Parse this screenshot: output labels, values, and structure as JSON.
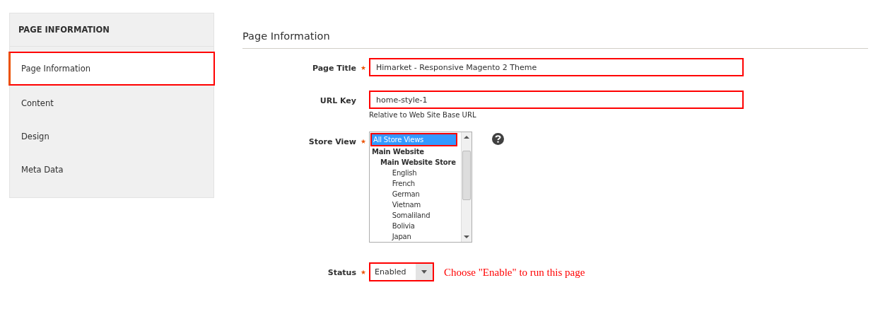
{
  "sidebar": {
    "title": "PAGE INFORMATION",
    "items": [
      {
        "label": "Page Information",
        "selected": true,
        "highlighted": true
      },
      {
        "label": "Content",
        "selected": false,
        "highlighted": false
      },
      {
        "label": "Design",
        "selected": false,
        "highlighted": false
      },
      {
        "label": "Meta Data",
        "selected": false,
        "highlighted": false
      }
    ]
  },
  "section": {
    "title": "Page Information"
  },
  "fields": [
    {
      "kind": "text",
      "label": "Page Title",
      "required": true,
      "value": "Himarket - Responsive Magento 2 Theme",
      "highlighted": true
    },
    {
      "kind": "text",
      "label": "URL Key",
      "required": false,
      "value": "home-style-1",
      "note": "Relative to Web Site Base URL",
      "highlighted": true
    },
    {
      "kind": "multiselect",
      "label": "Store View",
      "required": true,
      "help": true,
      "options": [
        {
          "label": "All Store Views",
          "selected": true,
          "highlighted": true
        },
        {
          "label": "Main Website",
          "selected": false,
          "highlighted": false,
          "children": [
            {
              "label": "Main Website Store",
              "selected": false,
              "highlighted": false,
              "children": [
                {
                  "label": "English",
                  "selected": false,
                  "highlighted": false
                },
                {
                  "label": "French",
                  "selected": false,
                  "highlighted": false
                },
                {
                  "label": "German",
                  "selected": false,
                  "highlighted": false
                },
                {
                  "label": "Vietnam",
                  "selected": false,
                  "highlighted": false
                },
                {
                  "label": "Somaliland",
                  "selected": false,
                  "highlighted": false
                },
                {
                  "label": "Bolivia",
                  "selected": false,
                  "highlighted": false
                },
                {
                  "label": "Japan",
                  "selected": false,
                  "highlighted": false
                }
              ]
            }
          ]
        }
      ]
    },
    {
      "kind": "select",
      "label": "Status",
      "required": true,
      "value": "Enabled",
      "highlighted": true,
      "annotation": "Choose \"Enable\" to run this page"
    }
  ]
}
